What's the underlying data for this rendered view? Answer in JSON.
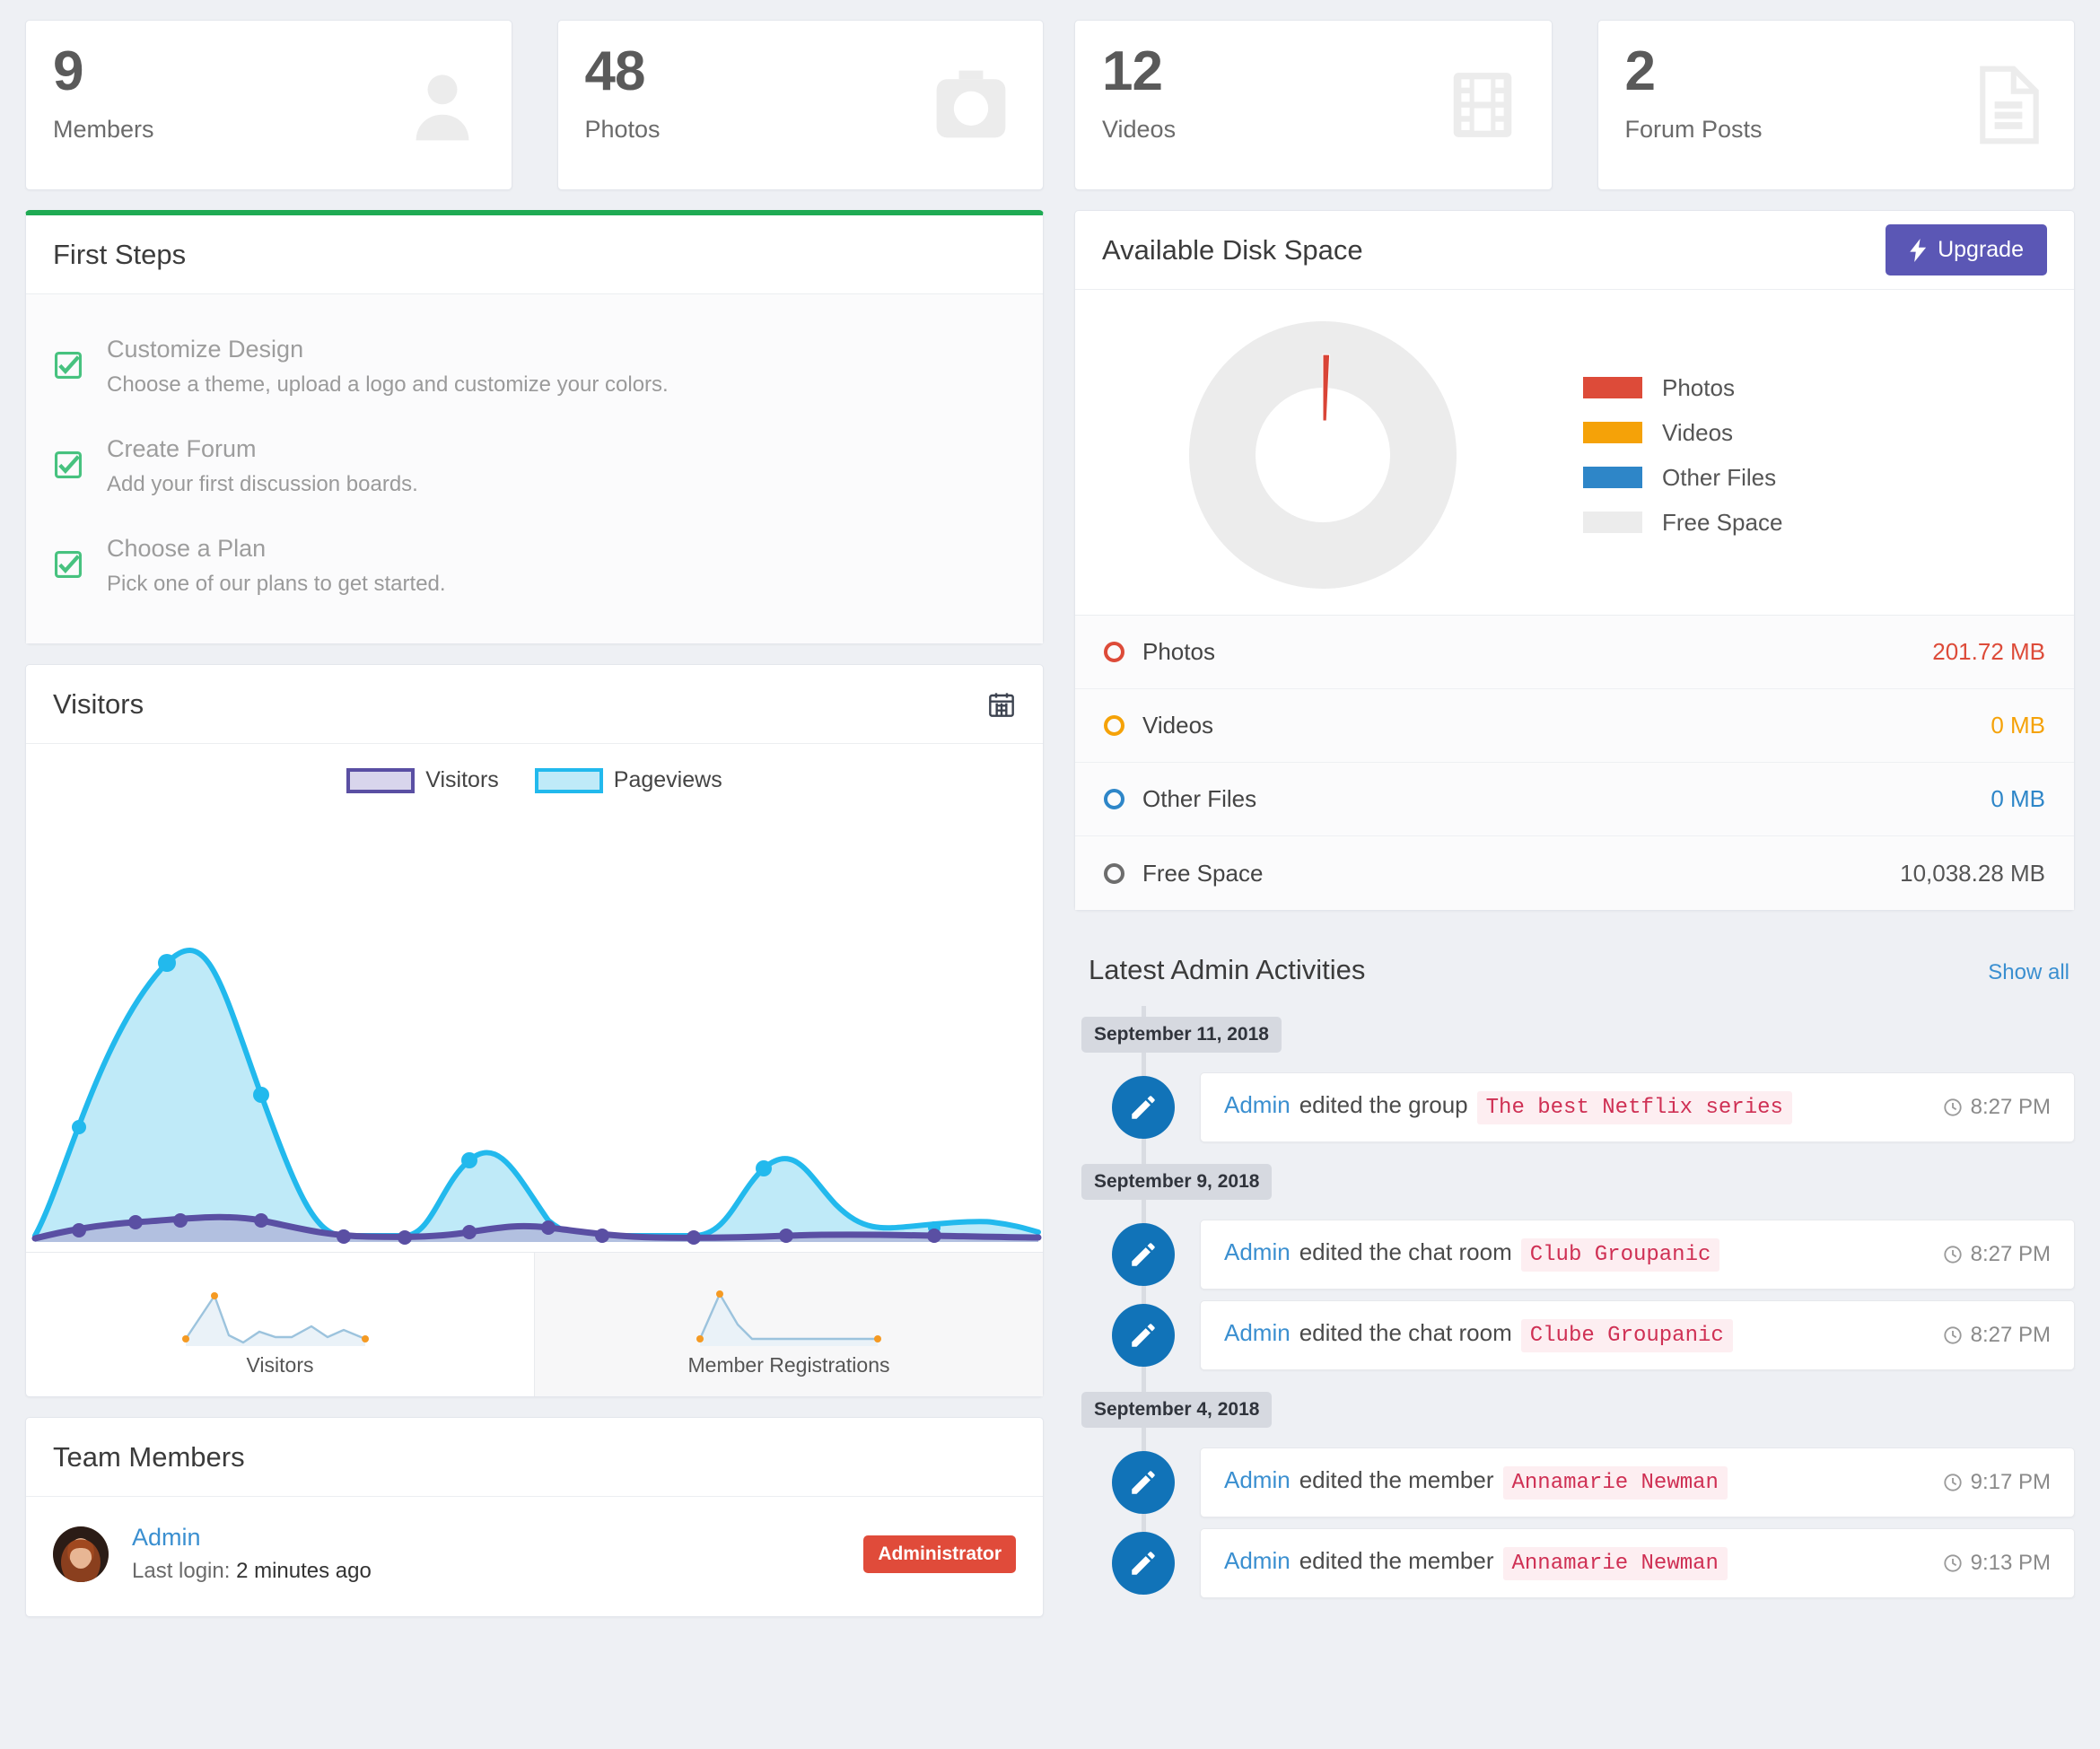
{
  "stats": [
    {
      "value": "9",
      "label": "Members",
      "icon": "user-icon"
    },
    {
      "value": "48",
      "label": "Photos",
      "icon": "camera-icon"
    },
    {
      "value": "12",
      "label": "Videos",
      "icon": "film-icon"
    },
    {
      "value": "2",
      "label": "Forum Posts",
      "icon": "document-icon"
    }
  ],
  "first_steps": {
    "title": "First Steps",
    "accent_color": "#1faa53",
    "items": [
      {
        "title": "Customize Design",
        "desc": "Choose a theme, upload a logo and customize your colors."
      },
      {
        "title": "Create Forum",
        "desc": "Add your first discussion boards."
      },
      {
        "title": "Choose a Plan",
        "desc": "Pick one of our plans to get started."
      }
    ]
  },
  "visitors": {
    "title": "Visitors",
    "calendar_icon": "calendar-icon",
    "legend": [
      {
        "label": "Visitors",
        "color": "#5a4fa3",
        "fill": "#d8d5ec"
      },
      {
        "label": "Pageviews",
        "color": "#22b9ed",
        "fill": "#bfeaf8"
      }
    ],
    "mini": [
      {
        "caption": "Visitors"
      },
      {
        "caption": "Member Registrations"
      }
    ]
  },
  "team": {
    "title": "Team Members",
    "members": [
      {
        "name": "Admin",
        "last_login_label": "Last login:",
        "last_login_value": "2 minutes ago",
        "role": "Administrator",
        "role_color": "#e04b3a"
      }
    ]
  },
  "disk": {
    "title": "Available Disk Space",
    "upgrade_label": "Upgrade",
    "upgrade_icon": "bolt-icon",
    "upgrade_color": "#5b57b5",
    "legend": [
      {
        "label": "Photos",
        "color": "#dd4b39"
      },
      {
        "label": "Videos",
        "color": "#f5a208"
      },
      {
        "label": "Other Files",
        "color": "#2e86c8"
      },
      {
        "label": "Free Space",
        "color": "#ececec"
      }
    ],
    "rows": [
      {
        "label": "Photos",
        "value": "201.72 MB",
        "color": "#dd4b39"
      },
      {
        "label": "Videos",
        "value": "0 MB",
        "color": "#f5a208"
      },
      {
        "label": "Other Files",
        "value": "0 MB",
        "color": "#2e86c8"
      },
      {
        "label": "Free Space",
        "value": "10,038.28 MB",
        "color": "#6d6d6d"
      }
    ]
  },
  "activities": {
    "title": "Latest Admin Activities",
    "show_all_label": "Show all",
    "groups": [
      {
        "date": "September 11, 2018",
        "items": [
          {
            "icon": "pencil-icon",
            "user": "Admin",
            "action": "edited the group",
            "object": "The best Netflix series",
            "time": "8:27 PM"
          }
        ]
      },
      {
        "date": "September 9, 2018",
        "items": [
          {
            "icon": "pencil-icon",
            "user": "Admin",
            "action": "edited the chat room",
            "object": "Club Groupanic",
            "time": "8:27 PM"
          },
          {
            "icon": "pencil-icon",
            "user": "Admin",
            "action": "edited the chat room",
            "object": "Clube Groupanic",
            "time": "8:27 PM"
          }
        ]
      },
      {
        "date": "September 4, 2018",
        "items": [
          {
            "icon": "pencil-icon",
            "user": "Admin",
            "action": "edited the member",
            "object": "Annamarie Newman",
            "time": "9:17 PM"
          },
          {
            "icon": "pencil-icon",
            "user": "Admin",
            "action": "edited the member",
            "object": "Annamarie Newman",
            "time": "9:13 PM"
          }
        ]
      }
    ]
  },
  "chart_data": [
    {
      "type": "area",
      "title": "Visitors",
      "xlabel": "",
      "ylabel": "",
      "grid": false,
      "legend_position": "top-center",
      "x": [
        0,
        1,
        2,
        3,
        4,
        5,
        6,
        7,
        8,
        9,
        10,
        11,
        12,
        13,
        14,
        15,
        16,
        17
      ],
      "series": [
        {
          "name": "Pageviews",
          "color": "#22b9ed",
          "fill": "#bfeaf8",
          "values": [
            2,
            26,
            100,
            18,
            0,
            0,
            11,
            0,
            0,
            2,
            12,
            7,
            11,
            1,
            0,
            0,
            1,
            5
          ]
        },
        {
          "name": "Visitors",
          "color": "#5a4fa3",
          "fill": "#b9c4e4",
          "values": [
            0,
            3,
            5,
            2,
            0,
            0,
            2,
            0,
            0,
            1,
            2,
            1,
            2,
            0,
            0,
            0,
            0,
            1
          ]
        }
      ]
    },
    {
      "type": "line",
      "title": "Visitors",
      "grid": false,
      "x": [
        0,
        1,
        2,
        3,
        4,
        5,
        6,
        7,
        8,
        9,
        10,
        11,
        12,
        13
      ],
      "values": [
        4,
        22,
        100,
        4,
        0,
        12,
        4,
        4,
        4,
        20,
        4,
        16,
        4,
        4
      ],
      "marker_color": "#f59a23",
      "line_color": "#9cc3dd"
    },
    {
      "type": "line",
      "title": "Member Registrations",
      "grid": false,
      "x": [
        0,
        1,
        2,
        3,
        4,
        5,
        6,
        7,
        8,
        9
      ],
      "values": [
        0,
        100,
        32,
        0,
        0,
        0,
        0,
        0,
        0,
        0
      ],
      "marker_color": "#f59a23",
      "line_color": "#9cc3dd"
    },
    {
      "type": "pie",
      "title": "Available Disk Space",
      "labels": [
        "Photos",
        "Videos",
        "Other Files",
        "Free Space"
      ],
      "values": [
        201.72,
        0,
        0,
        10038.28
      ],
      "colors": [
        "#dd4b39",
        "#f5a208",
        "#2e86c8",
        "#ececec"
      ],
      "donut": true,
      "legend_position": "right"
    }
  ]
}
